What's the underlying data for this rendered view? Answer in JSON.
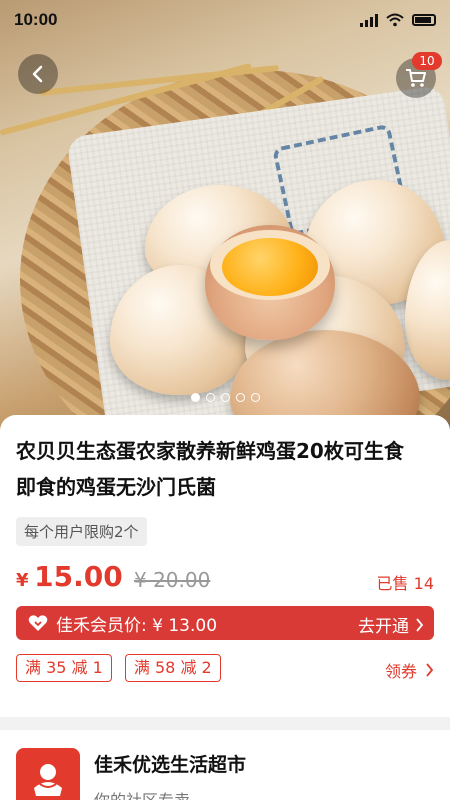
{
  "status_bar": {
    "time": "10:00"
  },
  "header": {
    "cart_count": "10"
  },
  "carousel": {
    "count": 5,
    "active_index": 0
  },
  "product": {
    "title_line1": "农贝贝生态蛋农家散养新鲜鸡蛋20枚可生食",
    "title_line2": "即食的鸡蛋无沙门氏菌",
    "limit_tag": "每个用户限购2个",
    "currency": "¥",
    "price": "15.00",
    "original_price": "¥ 20.00",
    "sold": "已售 14"
  },
  "member": {
    "label": "佳禾会员价: ¥ 13.00",
    "action": "去开通"
  },
  "coupons": {
    "items": [
      "满 35 减 1",
      "满 58 减 2"
    ],
    "get_label": "领券"
  },
  "store": {
    "name": "佳禾优选生活超市",
    "subtitle": "你的社区专卖"
  },
  "colors": {
    "accent": "#e23b2e",
    "member_bar": "#d93a35",
    "tag_bg": "#eeeeee"
  }
}
